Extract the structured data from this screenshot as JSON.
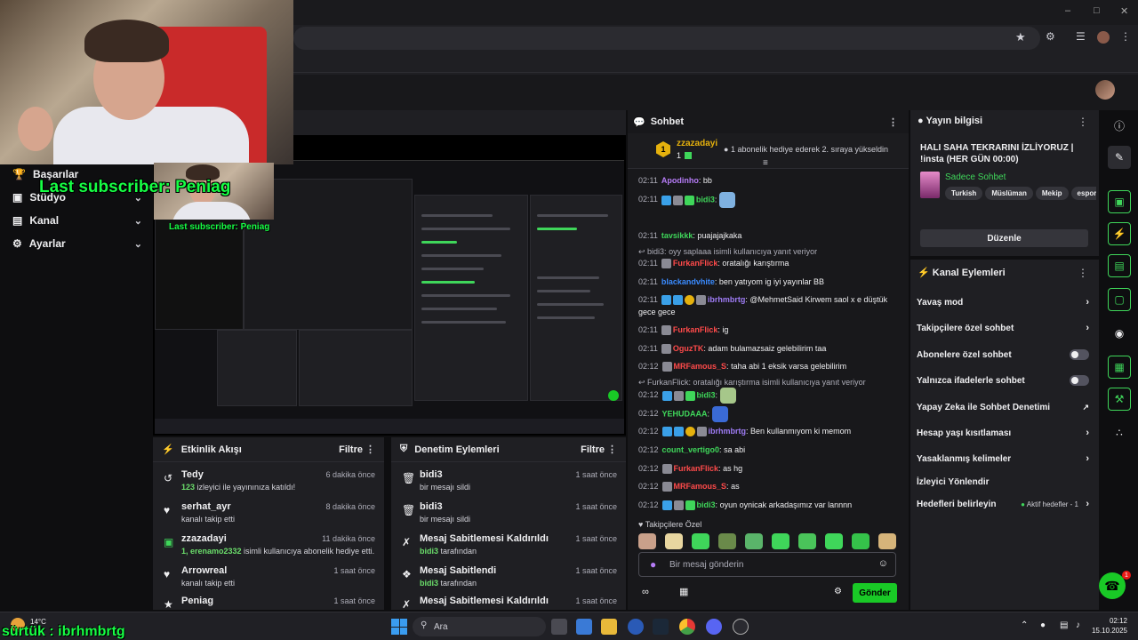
{
  "overlay": {
    "last_subscriber": "Last subscriber: Peniag",
    "last_subscriber_small": "Last subscriber: Peniag",
    "bottom_follower": "sürtük : ibrhmbrtg"
  },
  "left_menu": {
    "items": [
      {
        "label": "Başarılar",
        "icon": "trophy-icon"
      },
      {
        "label": "Stüdyo",
        "icon": "video-icon"
      },
      {
        "label": "Kanal",
        "icon": "channel-icon"
      },
      {
        "label": "Ayarlar",
        "icon": "gear-icon"
      }
    ]
  },
  "activity_feed": {
    "title": "Etkinlik Akışı",
    "filter_label": "Filtre",
    "items": [
      {
        "name": "Tedy",
        "desc_bold": "123",
        "desc": " izleyici ile yayınınıza katıldı!",
        "time": "6 dakika önce",
        "icon": "raid-icon"
      },
      {
        "name": "serhat_ayr",
        "desc_bold": "",
        "desc": "kanalı takip etti",
        "time": "8 dakika önce",
        "icon": "heart-icon"
      },
      {
        "name": "zzazadayi",
        "desc_bold": "1, erenamo2332",
        "desc": " isimli kullanıcıya abonelik hediye etti.",
        "time": "11 dakika önce",
        "icon": "gift-icon"
      },
      {
        "name": "Arrowreal",
        "desc_bold": "",
        "desc": "kanalı takip etti",
        "time": "1 saat önce",
        "icon": "heart-icon"
      },
      {
        "name": "Peniag",
        "desc_bold": "",
        "desc": "",
        "time": "1 saat önce",
        "icon": "star-icon"
      }
    ]
  },
  "moderation": {
    "title": "Denetim Eylemleri",
    "filter_label": "Filtre",
    "items": [
      {
        "name": "bidi3",
        "desc_bold": "",
        "desc": "bir mesajı sildi",
        "time": "1 saat önce",
        "icon": "trash-icon"
      },
      {
        "name": "bidi3",
        "desc_bold": "",
        "desc": "bir mesajı sildi",
        "time": "1 saat önce",
        "icon": "trash-icon"
      },
      {
        "name": "Mesaj Sabitlemesi Kaldırıldı",
        "desc_bold": "bidi3",
        "desc": " tarafından",
        "time": "1 saat önce",
        "icon": "unpin-icon"
      },
      {
        "name": "Mesaj Sabitlendi",
        "desc_bold": "bidi3",
        "desc": " tarafından",
        "time": "1 saat önce",
        "icon": "pin-icon"
      },
      {
        "name": "Mesaj Sabitlemesi Kaldırıldı",
        "desc_bold": "",
        "desc": "",
        "time": "1 saat önce",
        "icon": "unpin-icon"
      }
    ]
  },
  "chat": {
    "title": "Sohbet",
    "hype_user": "zzazadayi",
    "hype_count": "1",
    "hype_text": "1 abonelik hediye ederek 2. sıraya yükseldin",
    "messages": [
      {
        "ts": "02:11",
        "name": "Apodinho",
        "color": "#b57cf6",
        "text": "bb",
        "badges": []
      },
      {
        "ts": "02:11",
        "name": "bidi3",
        "color": "#3fd65a",
        "text": "",
        "badges": [
          "blue",
          "gray",
          "green"
        ],
        "emote": true
      },
      {
        "ts": "02:11",
        "name": "tavsikkk",
        "color": "#3fd65a",
        "text": "puajajajkaka",
        "badges": []
      },
      {
        "reply": "bidi3: oyy saplaaa isimli kullanıcıya yanıt veriyor"
      },
      {
        "ts": "02:11",
        "name": "FurkanFlick",
        "color": "#ff4a4a",
        "text": "oratalığı karıştırma",
        "badges": [
          "gray"
        ]
      },
      {
        "ts": "02:11",
        "name": "blackandvhite",
        "color": "#3a8bff",
        "text": "ben yatıyom ig iyi yayınlar BB",
        "badges": []
      },
      {
        "ts": "02:11",
        "name": "ibrhmbrtg",
        "color": "#9f7cf6",
        "text": "@MehmetSaid Kirwem saol x e düştük gece gece",
        "badges": [
          "blue",
          "blue",
          "gold",
          "gray"
        ],
        "wrap": true
      },
      {
        "ts": "02:11",
        "name": "FurkanFlick",
        "color": "#ff4a4a",
        "text": "ig",
        "badges": [
          "gray"
        ]
      },
      {
        "ts": "02:11",
        "name": "OguzTK",
        "color": "#ff4a4a",
        "text": "adam bulamazsaiz gelebilirim taa",
        "badges": [
          "gray"
        ]
      },
      {
        "ts": "02:12",
        "name": "MRFamous_S",
        "color": "#ff4a4a",
        "text": "taha abi 1 eksik varsa gelebilirim",
        "badges": [
          "gray"
        ]
      },
      {
        "reply": "FurkanFlick: oratalığı karıştırma isimli kullanıcıya yanıt veriyor"
      },
      {
        "ts": "02:12",
        "name": "bidi3",
        "color": "#3fd65a",
        "text": "",
        "badges": [
          "blue",
          "gray",
          "green"
        ],
        "emote": true
      },
      {
        "ts": "02:12",
        "name": "YEHUDAAA",
        "color": "#3fd65a",
        "text": "",
        "badges": [],
        "emote": true
      },
      {
        "ts": "02:12",
        "name": "ibrhmbrtg",
        "color": "#9f7cf6",
        "text": "Ben kullanmıyom ki memom",
        "badges": [
          "blue",
          "blue",
          "gold",
          "gray"
        ]
      },
      {
        "ts": "02:12",
        "name": "count_vertigo0",
        "color": "#3fd65a",
        "text": "sa abi",
        "badges": []
      },
      {
        "ts": "02:12",
        "name": "FurkanFlick",
        "color": "#ff4a4a",
        "text": "as hg",
        "badges": [
          "gray"
        ]
      },
      {
        "ts": "02:12",
        "name": "MRFamous_S",
        "color": "#ff4a4a",
        "text": "as",
        "badges": [
          "gray"
        ]
      },
      {
        "ts": "02:12",
        "name": "bidi3",
        "color": "#3fd65a",
        "text": "oyun oynicak arkadaşımız var lannnn",
        "badges": [
          "blue",
          "gray",
          "green"
        ]
      }
    ],
    "followers_only": "Takipçilere Özel",
    "input_placeholder": "Bir mesaj gönderin",
    "send_label": "Gönder"
  },
  "stream_info": {
    "title": "Yayın bilgisi",
    "stream_title": "HALI SAHA TEKRARINI İZLİYORUZ | !insta (HER GÜN 00:00)",
    "category": "Sadece Sohbet",
    "tags": [
      "Turkish",
      "Müslüman",
      "Mekip",
      "espor"
    ],
    "edit_label": "Düzenle"
  },
  "channel_actions": {
    "title": "Kanal Eylemleri",
    "items": [
      {
        "label": "Yavaş mod",
        "control": "chevron"
      },
      {
        "label": "Takipçilere özel sohbet",
        "control": "chevron"
      },
      {
        "label": "Abonelere özel sohbet",
        "control": "toggle"
      },
      {
        "label": "Yalnızca ifadelerle sohbet",
        "control": "toggle"
      },
      {
        "label": "Yapay Zeka ile Sohbet Denetimi",
        "control": "external"
      },
      {
        "label": "Hesap yaşı kısıtlaması",
        "control": "chevron"
      },
      {
        "label": "Yasaklanmış kelimeler",
        "control": "chevron"
      },
      {
        "label": "İzleyici Yönlendir",
        "control": "none"
      },
      {
        "label": "Hedefleri belirleyin",
        "control": "chevron"
      }
    ],
    "goals_status": "Aktif hedefler - 1"
  },
  "taskbar": {
    "weather_temp": "14°C",
    "search_placeholder": "Ara",
    "time": "02:12",
    "date": "15.10.2025"
  },
  "fab_badge": "1"
}
